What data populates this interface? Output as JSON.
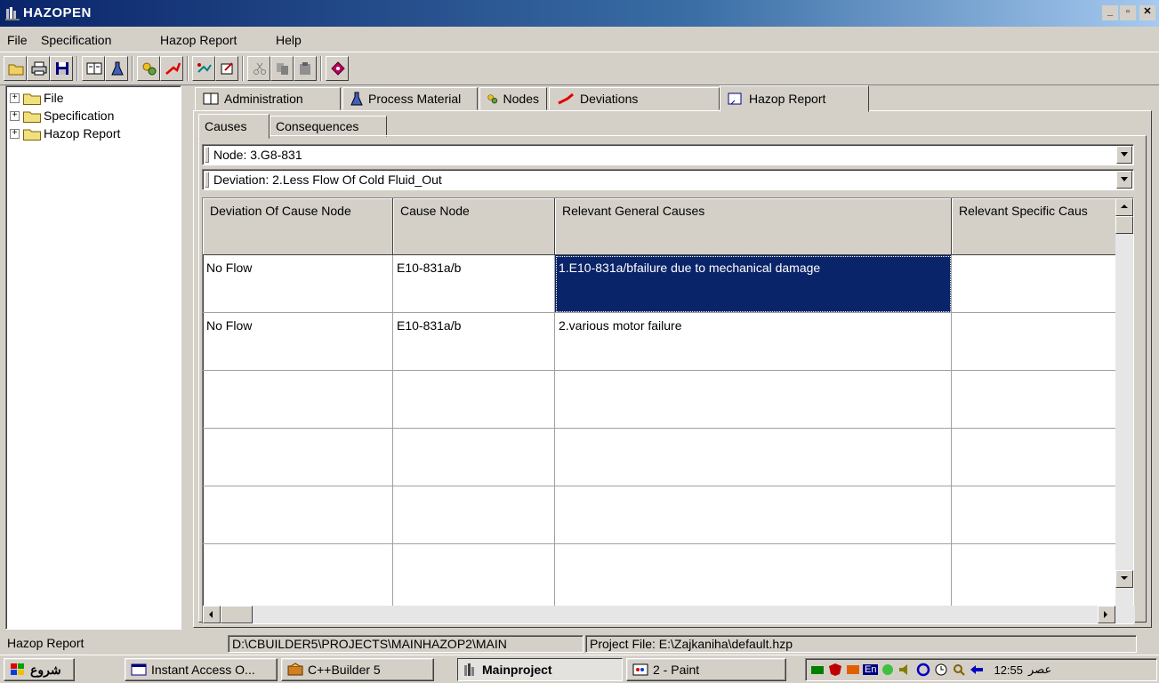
{
  "window": {
    "title": "HAZOPEN"
  },
  "menu": {
    "items": [
      "File",
      "Specification",
      "Hazop Report",
      "Help"
    ]
  },
  "toolbar": {
    "buttons": [
      "open-icon",
      "print-icon",
      "save-icon",
      "administration-icon",
      "process-material-icon",
      "nodes-icon",
      "deviations-icon",
      "tools-icon",
      "report-icon",
      "cut-icon",
      "copy-icon",
      "paste-icon",
      "help-icon"
    ]
  },
  "tree": {
    "items": [
      "File",
      "Specification",
      "Hazop Report"
    ]
  },
  "tabs": {
    "outer": [
      {
        "label": "Administration",
        "icon": "book-icon"
      },
      {
        "label": "Process Material",
        "icon": "flask-icon"
      },
      {
        "label": "Nodes",
        "icon": "nodes-icon"
      },
      {
        "label": "Deviations",
        "icon": "deviation-arrow-icon"
      },
      {
        "label": "Hazop Report",
        "icon": "report-icon"
      }
    ],
    "active_outer": "Hazop Report",
    "inner": [
      "Causes",
      "Consequences"
    ],
    "active_inner": "Causes"
  },
  "combos": {
    "node": "Node: 3.G8-831",
    "deviation": "Deviation: 2.Less Flow Of Cold Fluid_Out"
  },
  "grid": {
    "columns": [
      "Deviation Of Cause Node",
      "Cause Node",
      "Relevant General Causes",
      "Relevant Specific Caus"
    ],
    "rows": [
      [
        "No Flow",
        "E10-831a/b",
        "1.E10-831a/bfailure due to mechanical damage",
        ""
      ],
      [
        "No Flow",
        "E10-831a/b",
        "2.various motor failure",
        ""
      ],
      [
        "",
        "",
        "",
        ""
      ],
      [
        "",
        "",
        "",
        ""
      ],
      [
        "",
        "",
        "",
        ""
      ],
      [
        "",
        "",
        "",
        ""
      ]
    ],
    "selected": {
      "row": 0,
      "col": 2
    }
  },
  "statusbar": {
    "section": "Hazop Report",
    "path": "D:\\CBUILDER5\\PROJECTS\\MAINHAZOP2\\MAIN",
    "project": "Project File: E:\\Zajkaniha\\default.hzp"
  },
  "taskbar": {
    "start": "شروع",
    "tasks": [
      "Instant Access O...",
      "C++Builder 5",
      "Mainproject",
      "2 - Paint"
    ],
    "active_task": "Mainproject",
    "clock": "12:55",
    "clock_suffix": "عصر"
  },
  "colors": {
    "titlebar": "#0a246a",
    "selection": "#0a246a",
    "face": "#d4d0c8"
  }
}
